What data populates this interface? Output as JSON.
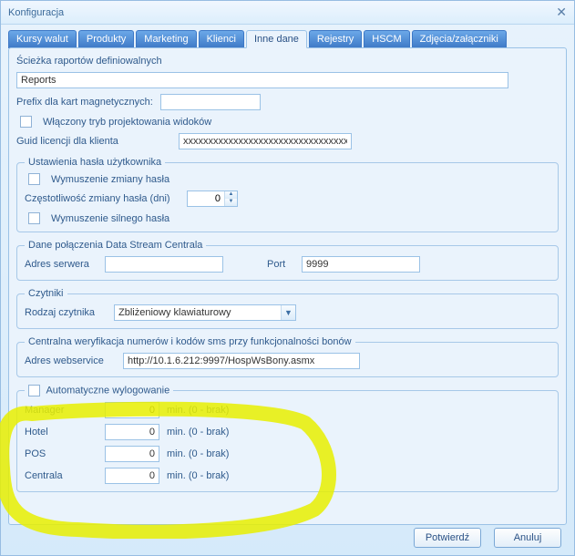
{
  "window": {
    "title": "Konfiguracja"
  },
  "tabs": {
    "items": [
      {
        "label": "Kursy walut"
      },
      {
        "label": "Produkty"
      },
      {
        "label": "Marketing"
      },
      {
        "label": "Klienci"
      },
      {
        "label": "Inne dane"
      },
      {
        "label": "Rejestry"
      },
      {
        "label": "HSCM"
      },
      {
        "label": "Zdjęcia/załączniki"
      }
    ],
    "activeIndex": 4
  },
  "paths": {
    "label": "Ścieżka raportów definiowalnych",
    "value": "Reports"
  },
  "prefix": {
    "label": "Prefix dla kart magnetycznych:",
    "value": ""
  },
  "designMode": {
    "label": "Włączony tryb projektowania widoków",
    "checked": false
  },
  "guid": {
    "label": "Guid licencji dla klienta",
    "value": "xxxxxxxxxxxxxxxxxxxxxxxxxxxxxxxxxxxxxxx"
  },
  "passwordSettings": {
    "legend": "Ustawienia hasła użytkownika",
    "forceChange": {
      "label": "Wymuszenie zmiany hasła",
      "checked": false
    },
    "frequency": {
      "label": "Częstotliwość zmiany hasła (dni)",
      "value": "0"
    },
    "forceStrong": {
      "label": "Wymuszenie silnego hasła",
      "checked": false
    }
  },
  "dataStream": {
    "legend": "Dane połączenia Data Stream Centrala",
    "serverLabel": "Adres serwera",
    "serverValue": "",
    "portLabel": "Port",
    "portValue": "9999"
  },
  "readers": {
    "legend": "Czytniki",
    "typeLabel": "Rodzaj czytnika",
    "typeValue": "Zbliżeniowy klawiaturowy"
  },
  "smsVerify": {
    "legend": "Centralna weryfikacja numerów i kodów sms przy funkcjonalności bonów",
    "wsLabel": "Adres webservice",
    "wsValue": "http://10.1.6.212:9997/HospWsBony.asmx"
  },
  "autoLogout": {
    "legend": "Automatyczne wylogowanie",
    "checked": false,
    "suffix": "min. (0 - brak)",
    "rows": [
      {
        "label": "Manager",
        "value": "0"
      },
      {
        "label": "Hotel",
        "value": "0"
      },
      {
        "label": "POS",
        "value": "0"
      },
      {
        "label": "Centrala",
        "value": "0"
      }
    ]
  },
  "buttons": {
    "confirm": "Potwierdź",
    "cancel": "Anuluj"
  }
}
